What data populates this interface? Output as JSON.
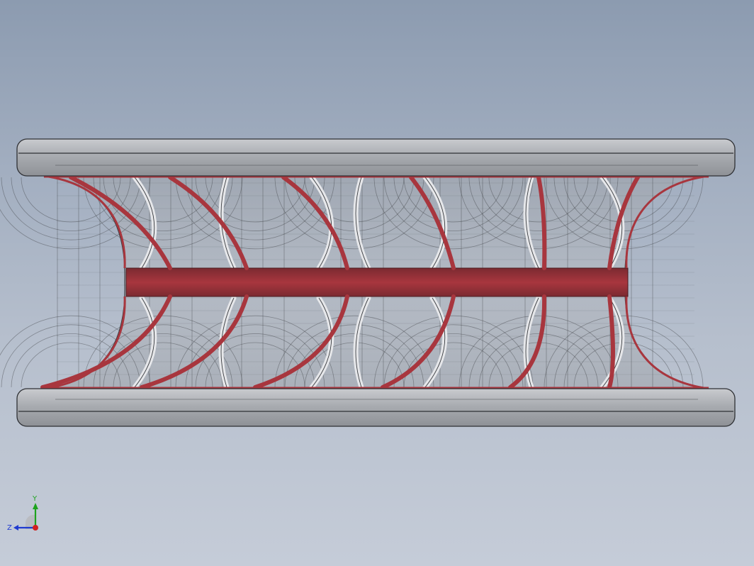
{
  "viewport": {
    "background_top": "#8c9bb0",
    "background_bottom": "#c5ccd8"
  },
  "model": {
    "frame_color": "#a5a8ad",
    "frame_edge_color": "#2e3034",
    "section_color": "#a8363e",
    "section_dark": "#7b2a31",
    "rib_color": "#d6d8dc"
  },
  "triad": {
    "x_label": "",
    "y_label": "Y",
    "z_label": "Z",
    "y_color": "#1ea31e",
    "z_color": "#1f3bd0",
    "x_color": "#d22020",
    "icon": "view-orientation-triad-icon"
  }
}
